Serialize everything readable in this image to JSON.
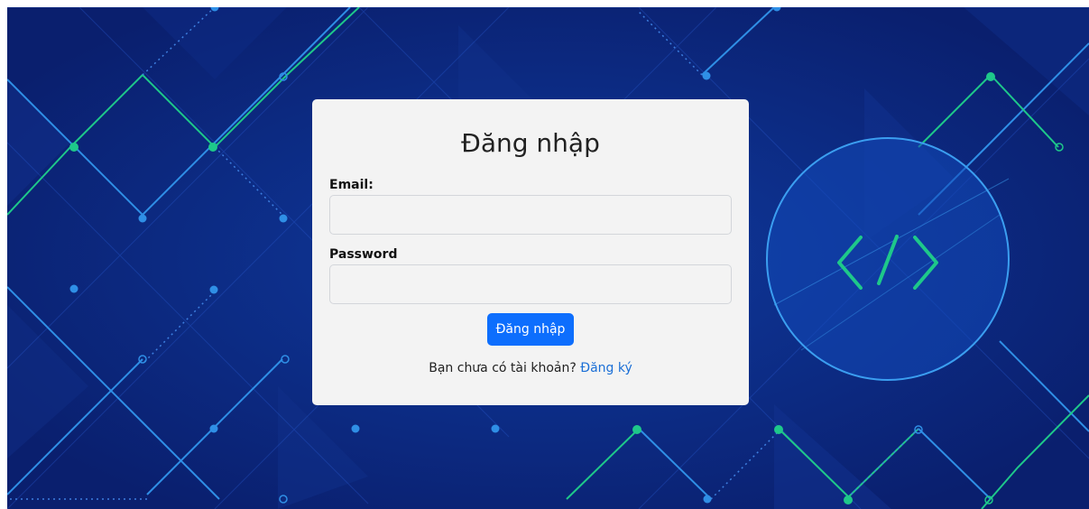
{
  "background": {
    "base_color": "#0a1f6e",
    "line_blue": "#2f8fe6",
    "line_green": "#1ec88a",
    "emblem_icon": "code-brackets-icon"
  },
  "login": {
    "title": "Đăng nhập",
    "email_label": "Email:",
    "email_value": "",
    "password_label": "Password",
    "password_value": "",
    "submit_label": "Đăng nhập",
    "register_prompt": "Bạn chưa có tài khoản?",
    "register_link": "Đăng ký"
  },
  "colors": {
    "card_bg": "#f3f3f3",
    "primary": "#0d6efd",
    "link": "#1b6fd6"
  }
}
